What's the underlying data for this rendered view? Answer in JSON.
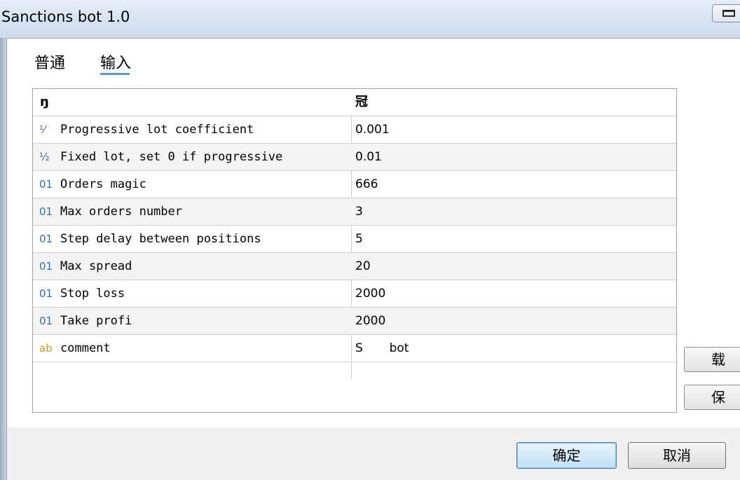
{
  "window": {
    "title": "Sanctions bot 1.0"
  },
  "tabs": [
    {
      "label": "普通",
      "active": false
    },
    {
      "label": "输入",
      "active": true
    }
  ],
  "grid": {
    "headers": {
      "name": "ŋ",
      "value": "冠"
    },
    "rows": [
      {
        "type_icon": "⅟",
        "type": "double",
        "name": "Progressive lot coefficient",
        "value": "0.001"
      },
      {
        "type_icon": "½",
        "type": "double",
        "name": "Fixed lot, set 0 if progressive",
        "value": "0.01"
      },
      {
        "type_icon": "01",
        "type": "int",
        "name": "Orders magic",
        "value": "666"
      },
      {
        "type_icon": "01",
        "type": "int",
        "name": "Max orders number",
        "value": "3"
      },
      {
        "type_icon": "01",
        "type": "int",
        "name": "Step delay between positions",
        "value": "5"
      },
      {
        "type_icon": "01",
        "type": "int",
        "name": "Max spread",
        "value": "20"
      },
      {
        "type_icon": "01",
        "type": "int",
        "name": "Stop loss",
        "value": "2000"
      },
      {
        "type_icon": "01",
        "type": "int",
        "name": "Take profi",
        "value": "2000"
      },
      {
        "type_icon": "ab",
        "type": "string",
        "name": "comment",
        "value": "S       bot"
      }
    ]
  },
  "side_buttons": [
    {
      "label": "载"
    },
    {
      "label": "保"
    }
  ],
  "footer": {
    "ok_label": "确定",
    "cancel_label": "取消"
  }
}
